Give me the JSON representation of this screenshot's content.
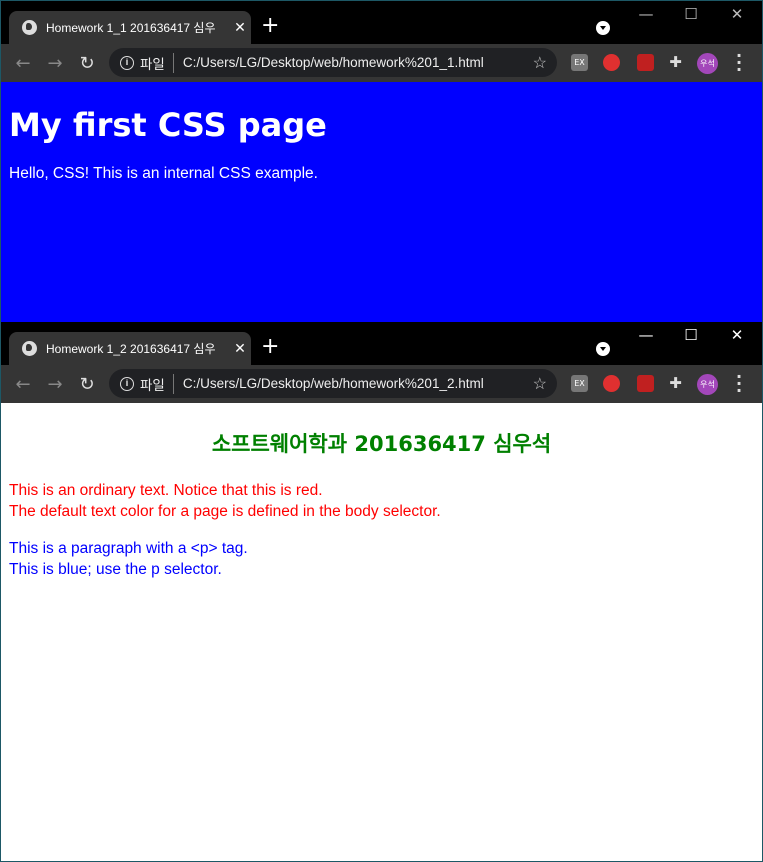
{
  "windows": [
    {
      "tab_title": "Homework 1_1 201636417 심우",
      "file_label": "파일",
      "url": "C:/Users/LG/Desktop/web/homework%201_1.html",
      "page": {
        "heading": "My first CSS page",
        "text": "Hello, CSS! This is an internal CSS example."
      }
    },
    {
      "tab_title": "Homework 1_2 201636417 심우",
      "file_label": "파일",
      "url": "C:/Users/LG/Desktop/web/homework%201_2.html",
      "page": {
        "heading": "소프트웨어학과 201636417 심우석",
        "red_lines": [
          "This is an ordinary text. Notice that this is red.",
          "The default text color for a page is defined in the body selector."
        ],
        "blue_lines": [
          "This is a paragraph with a <p> tag.",
          "This is blue; use the p selector."
        ]
      }
    }
  ],
  "profile": {
    "avatar_text": "우석"
  },
  "glyphs": {
    "close": "✕",
    "new_tab": "+",
    "back": "←",
    "forward": "→",
    "reload": "↻",
    "star": "☆",
    "min": "—",
    "max": "☐",
    "win_close": "✕",
    "ext_label": "EX",
    "menu": "⋮"
  },
  "colors": {
    "page1_bg": "#0000ff",
    "heading2": "#008000",
    "red_text": "#ff0000",
    "blue_text": "#0000ff",
    "avatar": "#a347ba"
  }
}
